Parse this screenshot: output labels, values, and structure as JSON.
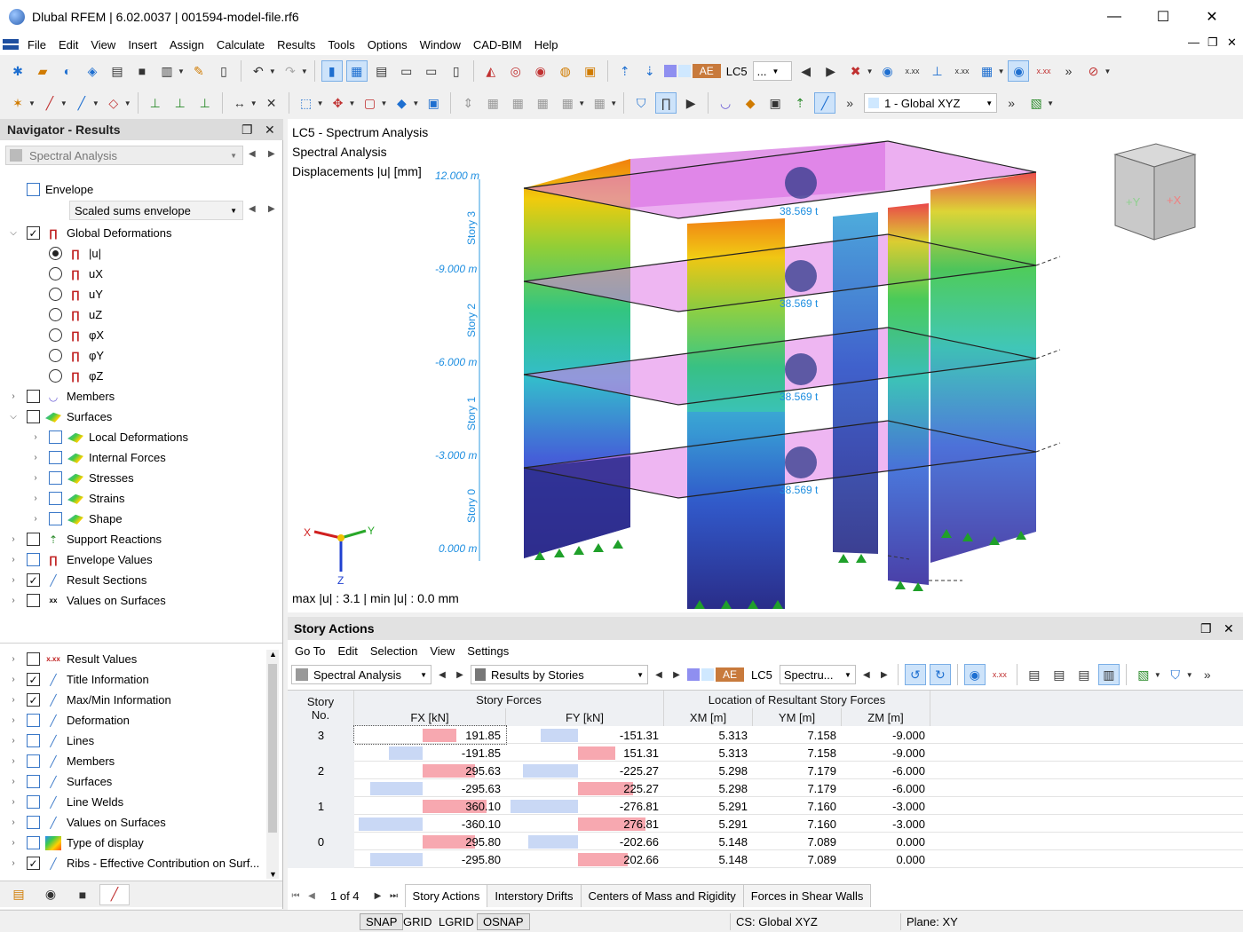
{
  "window": {
    "title": "Dlubal RFEM | 6.02.0037 | 001594-model-file.rf6",
    "minimize": "—",
    "maximize": "☐",
    "close": "✕"
  },
  "menu": [
    "File",
    "Edit",
    "View",
    "Insert",
    "Assign",
    "Calculate",
    "Results",
    "Tools",
    "Options",
    "Window",
    "CAD-BIM",
    "Help"
  ],
  "toolbar": {
    "ae_badge": "AE",
    "lc_label": "LC5",
    "lc_combo_value": "...",
    "coord_system": "1 - Global XYZ",
    "xxx": "x.xx"
  },
  "navigator": {
    "title": "Navigator - Results",
    "combo_analysis": "Spectral Analysis",
    "envelope_label": "Envelope",
    "envelope_combo": "Scaled sums envelope",
    "global_deformations": "Global Deformations",
    "deformation_options": [
      "|u|",
      "uX",
      "uY",
      "uZ",
      "φX",
      "φY",
      "φZ"
    ],
    "items_top": [
      {
        "label": "Members",
        "checked": false,
        "icon": "members-icon"
      },
      {
        "label": "Surfaces",
        "checked": false,
        "icon": "surfaces-icon"
      },
      {
        "label": "Local Deformations",
        "checked": false,
        "icon": "surfaces-icon"
      },
      {
        "label": "Internal Forces",
        "checked": false,
        "icon": "surfaces-icon"
      },
      {
        "label": "Stresses",
        "checked": false,
        "icon": "surfaces-icon"
      },
      {
        "label": "Strains",
        "checked": false,
        "icon": "surfaces-icon"
      },
      {
        "label": "Shape",
        "checked": false,
        "icon": "surfaces-icon"
      },
      {
        "label": "Support Reactions",
        "checked": false,
        "icon": "support-icon"
      },
      {
        "label": "Envelope Values",
        "checked": false,
        "icon": "envelope-icon"
      },
      {
        "label": "Result Sections",
        "checked": true,
        "icon": "result-section-icon"
      },
      {
        "label": "Values on Surfaces",
        "checked": false,
        "icon": "values-icon"
      }
    ],
    "items_bottom": [
      {
        "label": "Result Values",
        "checked": false
      },
      {
        "label": "Title Information",
        "checked": true
      },
      {
        "label": "Max/Min Information",
        "checked": true
      },
      {
        "label": "Deformation",
        "checked": false
      },
      {
        "label": "Lines",
        "checked": false
      },
      {
        "label": "Members",
        "checked": false
      },
      {
        "label": "Surfaces",
        "checked": false
      },
      {
        "label": "Line Welds",
        "checked": false
      },
      {
        "label": "Values on Surfaces",
        "checked": false
      },
      {
        "label": "Type of display",
        "checked": false
      },
      {
        "label": "Ribs - Effective Contribution on Surf...",
        "checked": true
      }
    ]
  },
  "view": {
    "info_line1": "LC5 - Spectrum Analysis",
    "info_line2": "Spectral Analysis",
    "info_line3": "Displacements |u| [mm]",
    "maxmin": "max |u| : 3.1 | min |u| : 0.0 mm",
    "levels": [
      "12.000 m",
      "-9.000 m",
      "-6.000 m",
      "-3.000 m",
      "0.000 m"
    ],
    "stories": [
      "Story 3",
      "Story 2",
      "Story 1",
      "Story 0"
    ],
    "mass_labels": [
      "38.569 t",
      "38.569 t",
      "38.569 t",
      "38.569 t"
    ],
    "axis_x": "X",
    "axis_y": "Y",
    "axis_z": "Z",
    "cube_y": "+Y",
    "cube_x": "+X"
  },
  "panel": {
    "title": "Story Actions",
    "menu": [
      "Go To",
      "Edit",
      "Selection",
      "View",
      "Settings"
    ],
    "combo_analysis": "Spectral Analysis",
    "combo_results": "Results by Stories",
    "ae_badge": "AE",
    "lc_label": "LC5",
    "lc_combo": "Spectru...",
    "headers": {
      "story": "Story",
      "story_no": "No.",
      "story_forces": "Story Forces",
      "fx": "FX [kN]",
      "fy": "FY [kN]",
      "location": "Location of Resultant Story Forces",
      "xm": "XM [m]",
      "ym": "YM [m]",
      "zm": "ZM [m]"
    },
    "rows": [
      {
        "story": "3",
        "fx": "191.85",
        "fx_frac": 0.533,
        "fy": "-151.31",
        "fy_frac": -0.547,
        "xm": "5.313",
        "ym": "7.158",
        "zm": "-9.000"
      },
      {
        "story": "",
        "fx": "-191.85",
        "fx_frac": -0.533,
        "fy": "151.31",
        "fy_frac": 0.547,
        "xm": "5.313",
        "ym": "7.158",
        "zm": "-9.000"
      },
      {
        "story": "2",
        "fx": "295.63",
        "fx_frac": 0.821,
        "fy": "-225.27",
        "fy_frac": -0.814,
        "xm": "5.298",
        "ym": "7.179",
        "zm": "-6.000"
      },
      {
        "story": "",
        "fx": "-295.63",
        "fx_frac": -0.821,
        "fy": "225.27",
        "fy_frac": 0.814,
        "xm": "5.298",
        "ym": "7.179",
        "zm": "-6.000"
      },
      {
        "story": "1",
        "fx": "360.10",
        "fx_frac": 1.0,
        "fy": "-276.81",
        "fy_frac": -1.0,
        "xm": "5.291",
        "ym": "7.160",
        "zm": "-3.000"
      },
      {
        "story": "",
        "fx": "-360.10",
        "fx_frac": -1.0,
        "fy": "276.81",
        "fy_frac": 1.0,
        "xm": "5.291",
        "ym": "7.160",
        "zm": "-3.000"
      },
      {
        "story": "0",
        "fx": "295.80",
        "fx_frac": 0.821,
        "fy": "-202.66",
        "fy_frac": -0.732,
        "xm": "5.148",
        "ym": "7.089",
        "zm": "0.000"
      },
      {
        "story": "",
        "fx": "-295.80",
        "fx_frac": -0.821,
        "fy": "202.66",
        "fy_frac": 0.732,
        "xm": "5.148",
        "ym": "7.089",
        "zm": "0.000"
      }
    ],
    "pager": "1 of 4",
    "tabs": [
      "Story Actions",
      "Interstory Drifts",
      "Centers of Mass and Rigidity",
      "Forces in Shear Walls"
    ]
  },
  "status": {
    "snap": "SNAP",
    "grid": "GRID",
    "lgrid": "LGRID",
    "osnap": "OSNAP",
    "cs": "CS: Global XYZ",
    "plane": "Plane: XY"
  },
  "colors": {
    "accent": "#1e6fd0",
    "bar_positive": "#f7a8b0",
    "bar_negative": "#c9d8f5"
  }
}
